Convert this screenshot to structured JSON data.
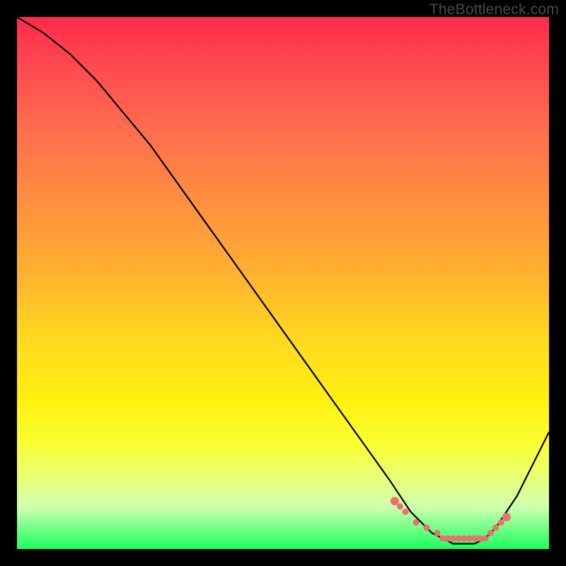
{
  "watermark": "TheBottleneck.com",
  "chart_data": {
    "type": "line",
    "title": "",
    "xlabel": "",
    "ylabel": "",
    "xlim": [
      0,
      100
    ],
    "ylim": [
      0,
      100
    ],
    "grid": false,
    "series": [
      {
        "name": "curve",
        "color": "#000000",
        "x": [
          0,
          5,
          10,
          15,
          20,
          25,
          30,
          35,
          40,
          45,
          50,
          55,
          60,
          65,
          70,
          72,
          74,
          76,
          78,
          80,
          82,
          84,
          86,
          88,
          90,
          92,
          94,
          96,
          98,
          100
        ],
        "values": [
          100,
          97,
          93,
          88,
          82,
          76,
          69,
          62,
          55,
          48,
          41,
          34,
          27,
          20,
          13,
          10,
          7,
          5,
          3,
          2,
          1,
          1,
          1,
          2,
          4,
          7,
          10,
          14,
          18,
          22
        ]
      },
      {
        "name": "highlight-dots",
        "color": "#ef6e6e",
        "type": "scatter",
        "x": [
          71,
          72,
          73,
          75,
          77,
          79,
          80,
          81,
          82,
          83,
          84,
          85,
          86,
          87,
          88,
          89,
          90,
          91,
          92
        ],
        "values": [
          9,
          8,
          7,
          5,
          4,
          3,
          2,
          2,
          2,
          2,
          2,
          2,
          2,
          2,
          2,
          3,
          4,
          5,
          6
        ]
      }
    ],
    "gradient_stops": [
      {
        "pos": 0,
        "color": "#ff2a4a"
      },
      {
        "pos": 20,
        "color": "#ff6a4e"
      },
      {
        "pos": 48,
        "color": "#ffb030"
      },
      {
        "pos": 72,
        "color": "#fff010"
      },
      {
        "pos": 100,
        "color": "#1aff60"
      }
    ]
  }
}
